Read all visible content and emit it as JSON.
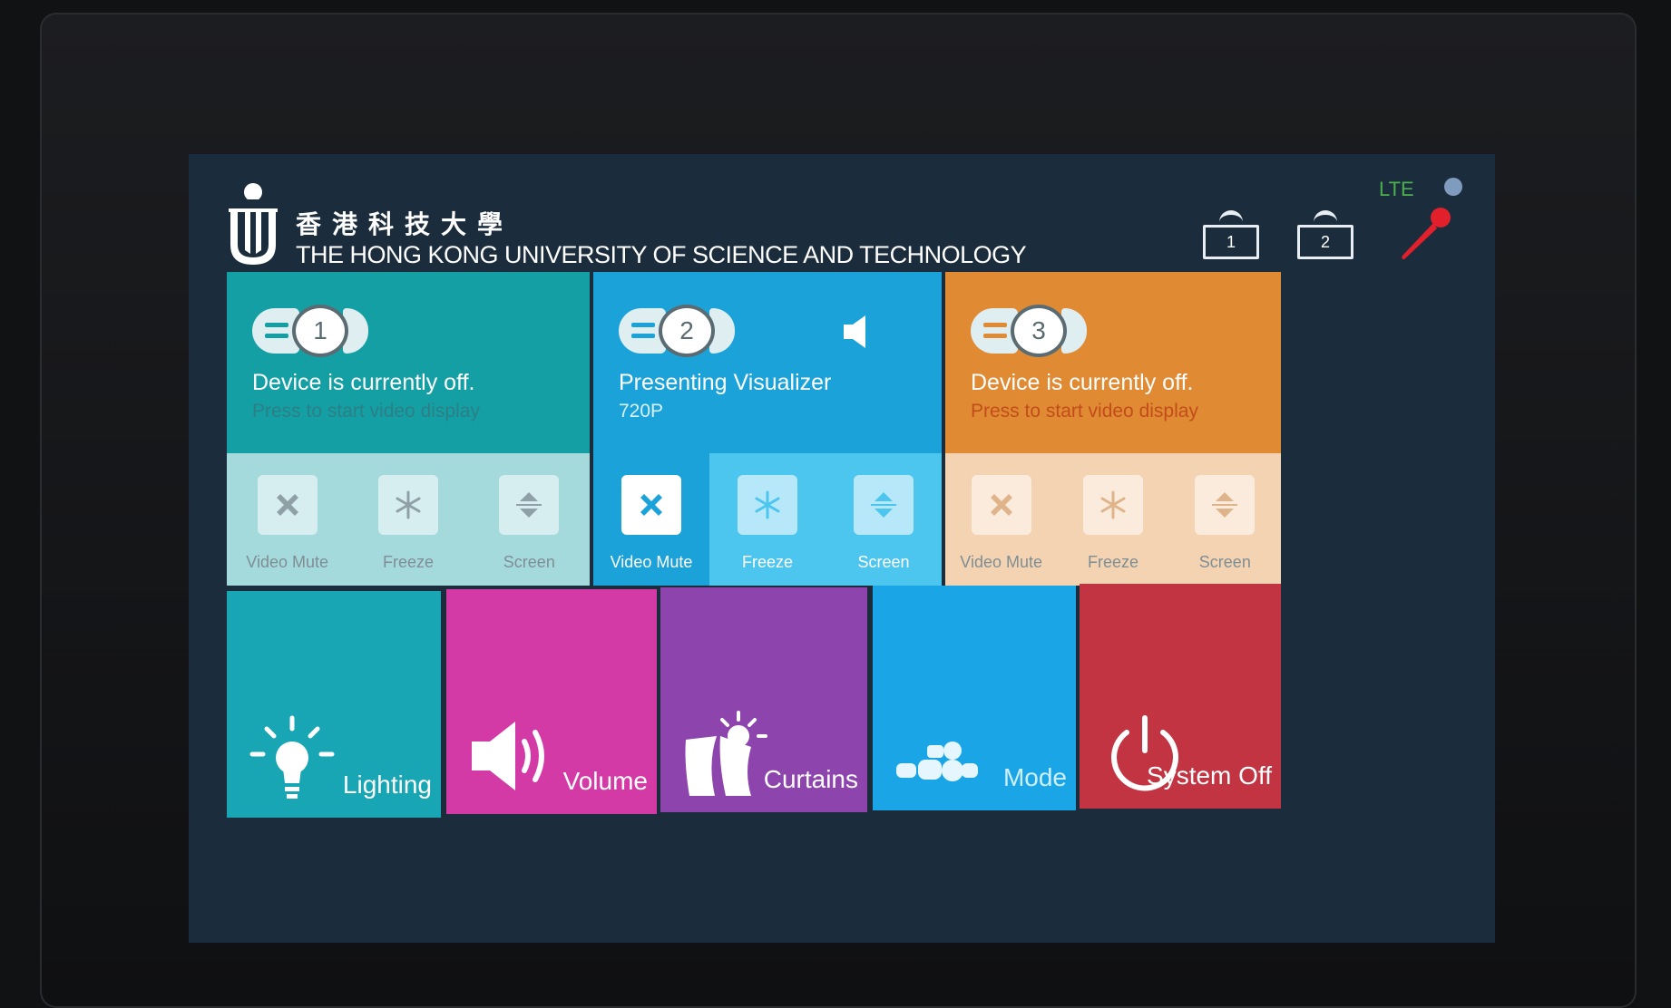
{
  "header": {
    "university_zh": "香港科技大學",
    "university_en": "THE HONG KONG UNIVERSITY OF SCIENCE AND TECHNOLOGY",
    "lte_label": "LTE",
    "display_buttons": [
      "1",
      "2"
    ],
    "icons": {
      "logo": "hkust-logo",
      "microphone": "microphone-icon"
    }
  },
  "sources": [
    {
      "number": "1",
      "status": "Device is currently off.",
      "subtext": "Press to start video display",
      "color": "#149fa4",
      "controls": [
        "Video Mute",
        "Freeze",
        "Screen"
      ]
    },
    {
      "number": "2",
      "status": "Presenting Visualizer",
      "subtext": "720P",
      "color": "#1aa2d9",
      "controls": [
        "Video Mute",
        "Freeze",
        "Screen"
      ],
      "icon": "speaker-icon"
    },
    {
      "number": "3",
      "status": "Device is currently off.",
      "subtext": "Press to start video display",
      "color": "#e08b34",
      "controls": [
        "Video Mute",
        "Freeze",
        "Screen"
      ]
    }
  ],
  "functions": [
    {
      "label": "Lighting",
      "icon": "lightbulb-icon",
      "color": "#18a5b4"
    },
    {
      "label": "Volume",
      "icon": "speaker-icon",
      "color": "#d43aa6"
    },
    {
      "label": "Curtains",
      "icon": "curtains-icon",
      "color": "#8d44ad"
    },
    {
      "label": "Mode",
      "icon": "mode-icon",
      "color": "#1aa6e6"
    },
    {
      "label": "System Off",
      "icon": "power-icon",
      "color": "#c23442"
    }
  ]
}
